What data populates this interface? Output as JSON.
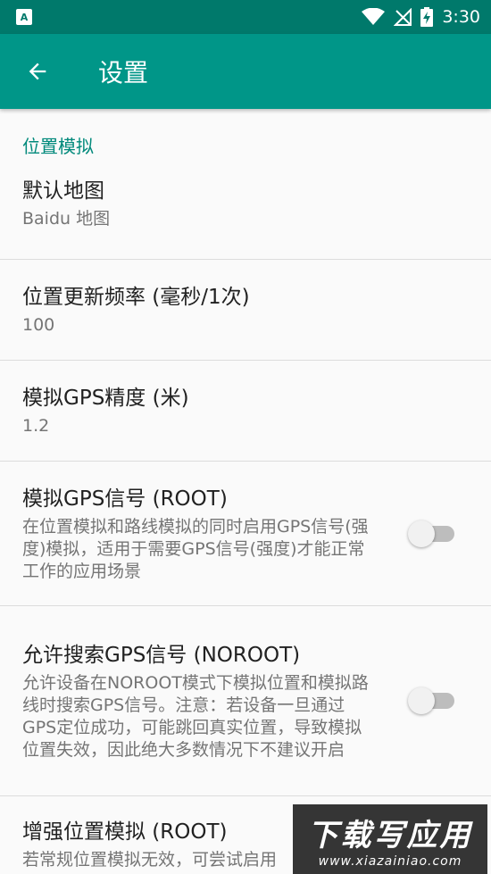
{
  "status_bar": {
    "time": "3:30",
    "app_badge": "A"
  },
  "toolbar": {
    "title": "设置"
  },
  "category": {
    "label": "位置模拟"
  },
  "prefs": [
    {
      "title": "默认地图",
      "summary": "Baidu 地图"
    },
    {
      "title": "位置更新频率 (毫秒/1次)",
      "summary": "100"
    },
    {
      "title": "模拟GPS精度 (米)",
      "summary": "1.2"
    },
    {
      "title": "模拟GPS信号 (ROOT)",
      "summary": "在位置模拟和路线模拟的同时启用GPS信号(强度)模拟，适用于需要GPS信号(强度)才能正常工作的应用场景",
      "checked": false
    },
    {
      "title": "允许搜索GPS信号 (NOROOT)",
      "summary": "允许设备在NOROOT模式下模拟位置和模拟路线时搜索GPS信号。注意：若设备一旦通过GPS定位成功，可能跳回真实位置，导致模拟位置失效，因此绝大多数情况下不建议开启",
      "checked": false
    },
    {
      "title": "增强位置模拟 (ROOT)",
      "summary": "若常规位置模拟无效，可尝试启用"
    }
  ],
  "watermark": {
    "big": "下载写应用",
    "small": "www.xiazainiao.com"
  },
  "colors": {
    "primary": "#009688",
    "primary_dark": "#00796b",
    "accent": "#00897b"
  }
}
